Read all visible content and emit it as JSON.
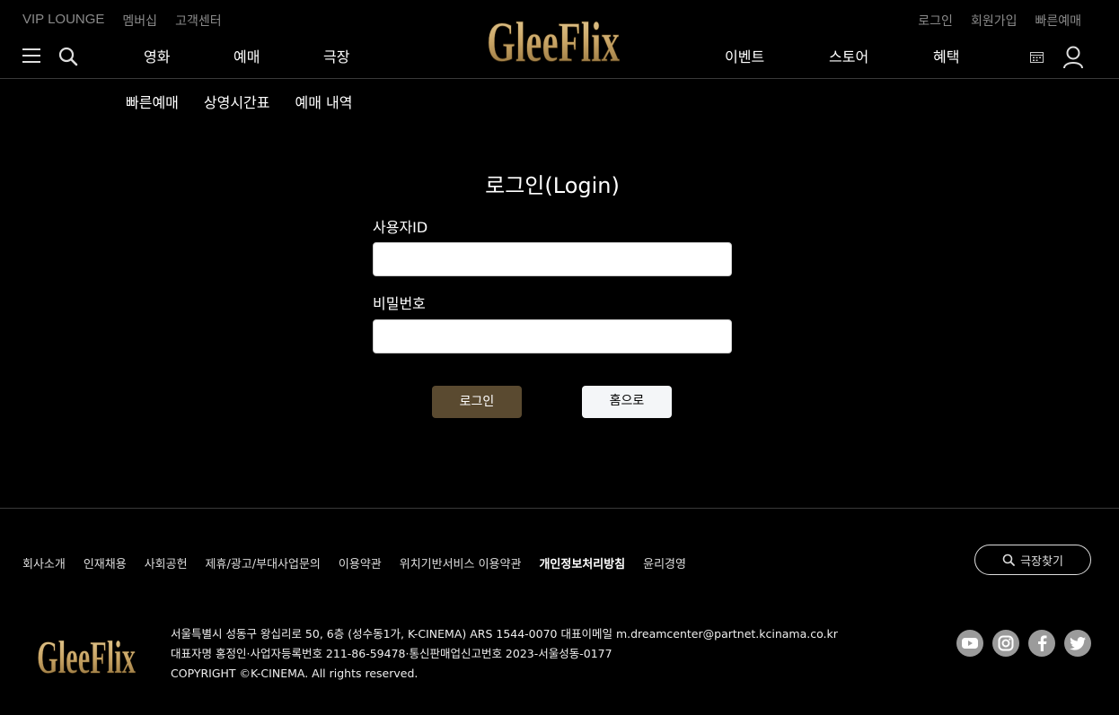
{
  "header": {
    "util_left": [
      "VIP LOUNGE",
      "멤버십",
      "고객센터"
    ],
    "util_right": [
      "로그인",
      "회원가입",
      "빠른예매"
    ],
    "nav_left": [
      "영화",
      "예매",
      "극장"
    ],
    "nav_right": [
      "이벤트",
      "스토어",
      "혜택"
    ],
    "logo_text": "GleeFlix",
    "icons": [
      "menu-icon",
      "search-icon",
      "calendar-icon",
      "user-icon"
    ]
  },
  "subnav": [
    "빠른예매",
    "상영시간표",
    "예매 내역"
  ],
  "login": {
    "title": "로그인(Login)",
    "id_label": "사용자ID",
    "id_value": "",
    "password_label": "비밀번호",
    "password_value": "",
    "login_button": "로그인",
    "home_button": "홈으로"
  },
  "footer": {
    "links": [
      "회사소개",
      "인재채용",
      "사회공헌",
      "제휴/광고/부대사업문의",
      "이용약관",
      "위치기반서비스 이용약관",
      "개인정보처리방침",
      "윤리경영"
    ],
    "find_theater": "극장찾기",
    "logo_text": "GleeFlix",
    "info_line1": "서울특별시 성동구 왕십리로 50, 6층 (성수동1가, K-CINEMA) ARS 1544-0070 대표이메일 m.dreamcenter@partnet.kcinama.co.kr",
    "info_line2": "대표자명 홍정인·사업자등록번호 211-86-59478·통신판매업신고번호 2023-서울성동-0177",
    "info_line3": "COPYRIGHT ©K-CINEMA. All rights reserved.",
    "sns": [
      "youtube-icon",
      "instagram-icon",
      "facebook-icon",
      "twitter-icon"
    ]
  },
  "colors": {
    "background": "#000000",
    "gold": "#c9a566",
    "login_button": "#5a4a30",
    "home_button": "#f4f6f8",
    "muted_text": "#8a8a8a"
  }
}
